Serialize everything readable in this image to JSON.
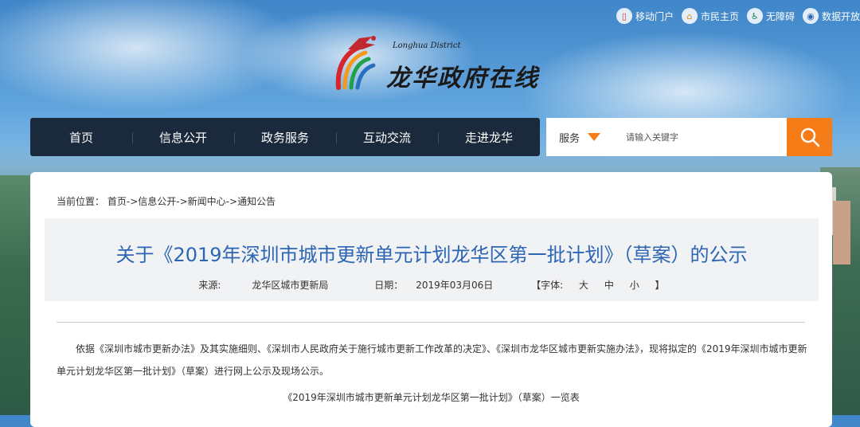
{
  "top_links": [
    {
      "label": "移动门户",
      "icon": "mobile-portal-icon"
    },
    {
      "label": "市民主页",
      "icon": "home-icon"
    },
    {
      "label": "无障碍",
      "icon": "accessibility-icon"
    },
    {
      "label": "数据开放",
      "icon": "data-open-icon"
    }
  ],
  "logo": {
    "title": "龙华政府在线",
    "subtitle": "Longhua District"
  },
  "nav": {
    "items": [
      "首页",
      "信息公开",
      "政务服务",
      "互动交流",
      "走进龙华"
    ]
  },
  "search": {
    "type_label": "服务",
    "placeholder": "请输入关键字",
    "accent_color": "#f57c16"
  },
  "breadcrumb": {
    "prefix": "当前位置：",
    "items": [
      "首页",
      "信息公开",
      "新闻中心",
      "通知公告"
    ],
    "separator": "->"
  },
  "article": {
    "title": "关于《2019年深圳市城市更新单元计划龙华区第一批计划》（草案）的公示",
    "source_label": "来源:",
    "source_value": "龙华区城市更新局",
    "date_label": "日期：",
    "date_value": "2019年03月06日",
    "font_label": "【字体:",
    "font_options": [
      "大",
      "中",
      "小"
    ],
    "font_close": "】",
    "paragraph": "依据《深圳市城市更新办法》及其实施细则、《深圳市人民政府关于施行城市更新工作改革的决定》、《深圳市龙华区城市更新实施办法》，现将拟定的《2019年深圳市城市更新单元计划龙华区第一批计划》（草案）进行网上公示及现场公示。",
    "caption": "《2019年深圳市城市更新单元计划龙华区第一批计划》（草案）一览表",
    "title_color": "#2c65b4"
  }
}
